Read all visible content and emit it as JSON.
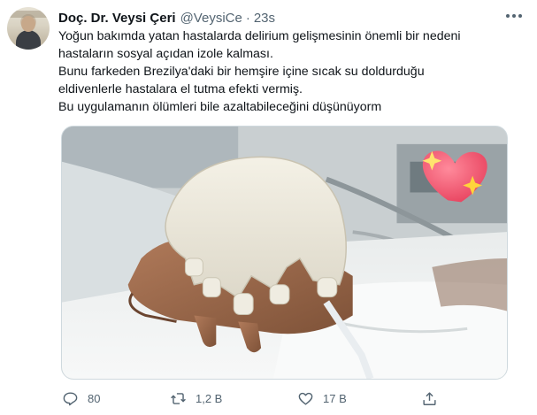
{
  "tweet": {
    "author_name": "Doç. Dr. Veysi Çeri",
    "handle": "@VeysiCe",
    "separator": "·",
    "time": "23s",
    "lines": [
      "Yoğun bakımda yatan hastalarda delirium gelişmesinin önemli bir nedeni",
      "hastaların sosyal açıdan izole kalması.",
      "Bunu farkeden Brezilya'daki bir hemşire içine sıcak su doldurduğu",
      "eldivenlerle hastalara el tutma efekti vermiş.",
      "Bu uygulamanın ölümleri bile azaltabileceğini düşünüyorm"
    ]
  },
  "actions": {
    "reply_count": "80",
    "retweet_count": "1,2 B",
    "like_count": "17 B"
  },
  "icons": {
    "more": "more-icon",
    "reply": "reply-icon",
    "retweet": "retweet-icon",
    "like": "heart-icon",
    "share": "share-icon"
  },
  "colors": {
    "text": "#0f1419",
    "secondary": "#536471",
    "heart": "#f0506e",
    "sparkle": "#ffd43b"
  }
}
